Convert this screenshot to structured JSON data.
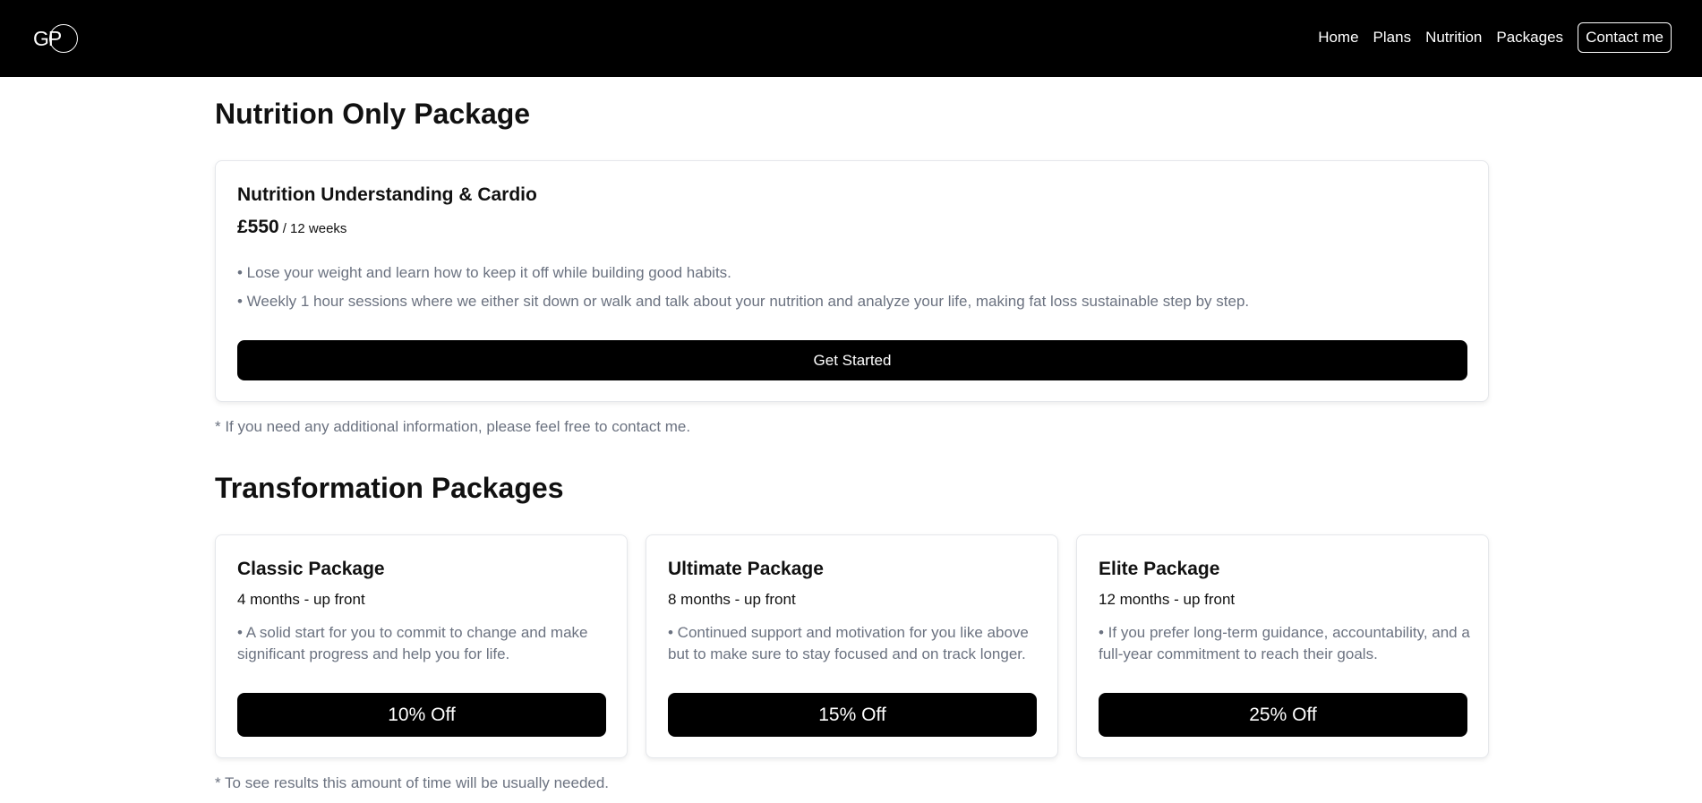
{
  "brand": {
    "logo_text": "GP"
  },
  "nav": {
    "links": [
      "Home",
      "Plans",
      "Nutrition",
      "Packages"
    ],
    "contact_label": "Contact me"
  },
  "nutrition_section": {
    "title": "Nutrition Only Package",
    "card": {
      "title": "Nutrition Understanding & Cardio",
      "price": "£550",
      "period": "/ 12 weeks",
      "bullets": [
        "• Lose your weight and learn how to keep it off while building good habits.",
        "• Weekly 1 hour sessions where we either sit down or walk and talk about your nutrition and analyze your life, making fat loss sustainable step by step."
      ],
      "cta_label": "Get Started"
    },
    "note": "* If you need any additional information, please feel free to contact me."
  },
  "transformation_section": {
    "title": "Transformation Packages",
    "packages": [
      {
        "title": "Classic Package",
        "duration": "4 months - up front",
        "description": "• A solid start for you to commit to change and make significant progress and help you for life.",
        "discount_label": "10% Off"
      },
      {
        "title": "Ultimate Package",
        "duration": "8 months - up front",
        "description": "• Continued support and motivation for you like above but to make sure to stay focused and on track longer.",
        "discount_label": "15% Off"
      },
      {
        "title": "Elite Package",
        "duration": "12 months - up front",
        "description": "• If you prefer long-term guidance, accountability, and a full-year commitment to reach their goals.",
        "discount_label": "25% Off"
      }
    ],
    "note": "* To see results this amount of time will be usually needed."
  }
}
